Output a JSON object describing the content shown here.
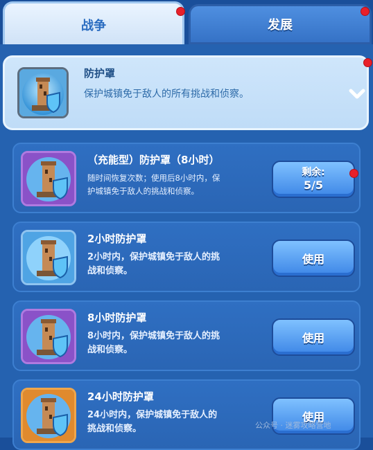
{
  "tabs": {
    "war": "战争",
    "development": "发展"
  },
  "shield": {
    "title": "防护罩",
    "description": "保护城镇免于敌人的所有挑战和侦察。"
  },
  "items": [
    {
      "title": "（充能型）防护罩（8小时）",
      "desc_line1": "随时间恢复次数；使用后8小时内，保",
      "desc_line2": "护城镇免于敌人的挑战和侦察。",
      "button_label": "剩余:",
      "button_value": "5/5",
      "frame": "purple"
    },
    {
      "title": "2小时防护罩",
      "desc_line1": "2小时内，保护城镇免于敌人的挑",
      "desc_line2": "战和侦察。",
      "button_label": "使用",
      "frame": "blue"
    },
    {
      "title": "8小时防护罩",
      "desc_line1": "8小时内，保护城镇免于敌人的挑",
      "desc_line2": "战和侦察。",
      "button_label": "使用",
      "frame": "purple"
    },
    {
      "title": "24小时防护罩",
      "desc_line1": "24小时内，保护城镇免于敌人的",
      "desc_line2": "挑战和侦察。",
      "button_label": "使用",
      "frame": "orange"
    }
  ],
  "watermark": "公众号 · 迷雾攻略营地",
  "colors": {
    "panel": "#2562b0",
    "notification_dot": "#e8202a",
    "button": "#4a94ee"
  },
  "icons": [
    "shield-tower-icon",
    "chevron-down-icon",
    "notification-dot"
  ]
}
